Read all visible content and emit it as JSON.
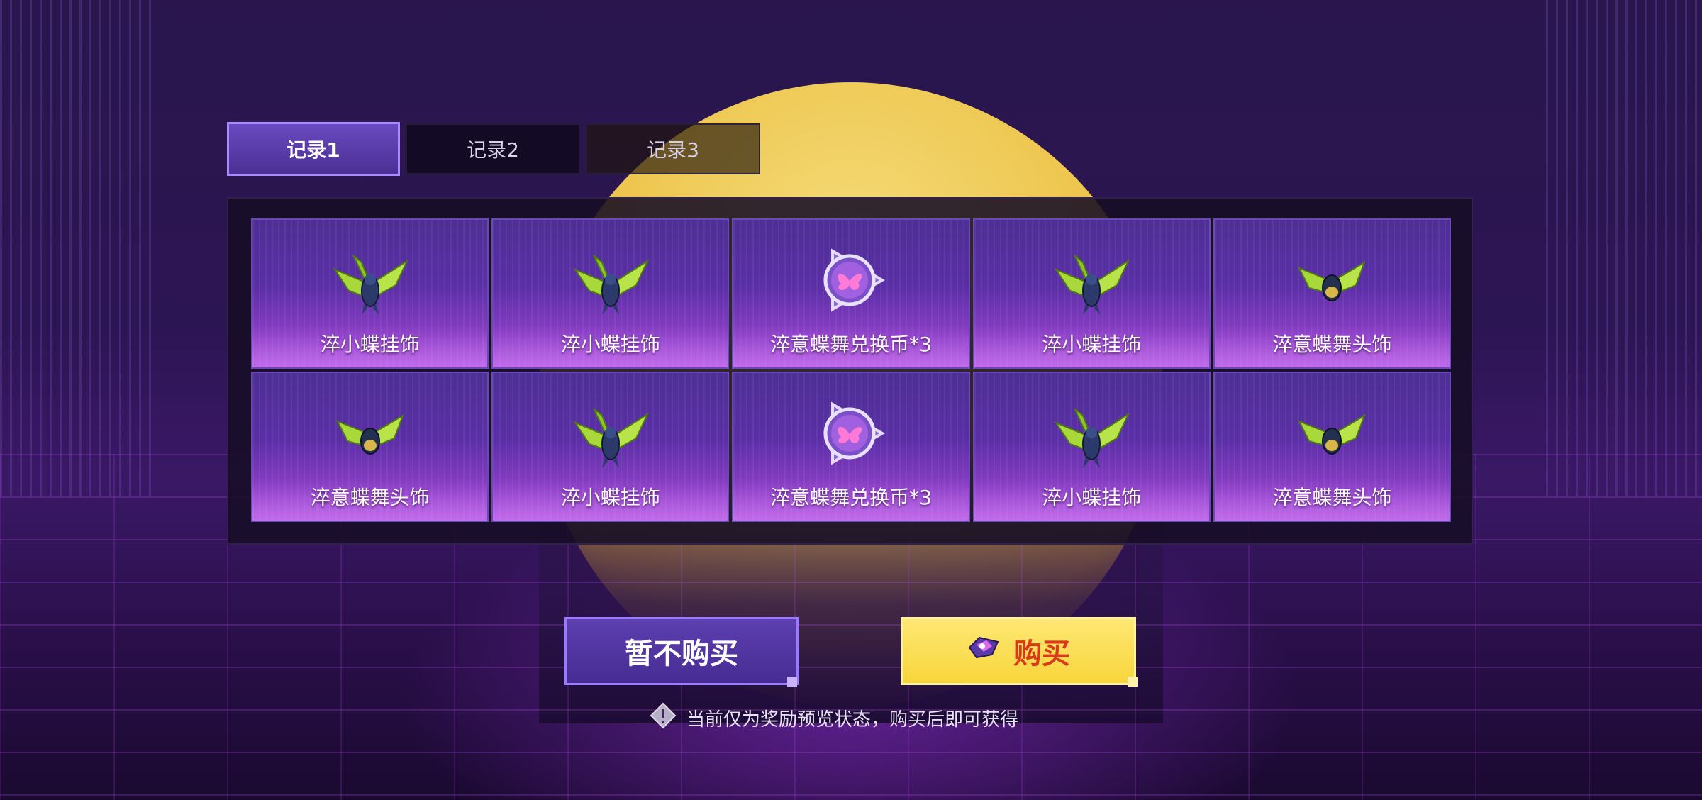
{
  "tabs": [
    {
      "label": "记录1",
      "active": true
    },
    {
      "label": "记录2",
      "active": false
    },
    {
      "label": "记录3",
      "active": false
    }
  ],
  "rewards": [
    {
      "label": "淬小蝶挂饰",
      "icon": "butterfly-pendant-icon"
    },
    {
      "label": "淬小蝶挂饰",
      "icon": "butterfly-pendant-icon"
    },
    {
      "label": "淬意蝶舞兑换币*3",
      "icon": "exchange-coin-icon"
    },
    {
      "label": "淬小蝶挂饰",
      "icon": "butterfly-pendant-icon"
    },
    {
      "label": "淬意蝶舞头饰",
      "icon": "butterfly-headwear-icon"
    },
    {
      "label": "淬意蝶舞头饰",
      "icon": "butterfly-headwear-icon"
    },
    {
      "label": "淬小蝶挂饰",
      "icon": "butterfly-pendant-icon"
    },
    {
      "label": "淬意蝶舞兑换币*3",
      "icon": "exchange-coin-icon"
    },
    {
      "label": "淬小蝶挂饰",
      "icon": "butterfly-pendant-icon"
    },
    {
      "label": "淬意蝶舞头饰",
      "icon": "butterfly-headwear-icon"
    }
  ],
  "buttons": {
    "cancel_label": "暂不购买",
    "buy_label": "购买",
    "buy_icon": "currency-gem-icon"
  },
  "notice": {
    "icon": "warning-icon",
    "text": "当前仅为奖励预览状态，购买后即可获得"
  },
  "colors": {
    "accent_purple": "#9a7bff",
    "buy_yellow": "#f7d53b",
    "buy_text_red": "#d83a1a"
  }
}
